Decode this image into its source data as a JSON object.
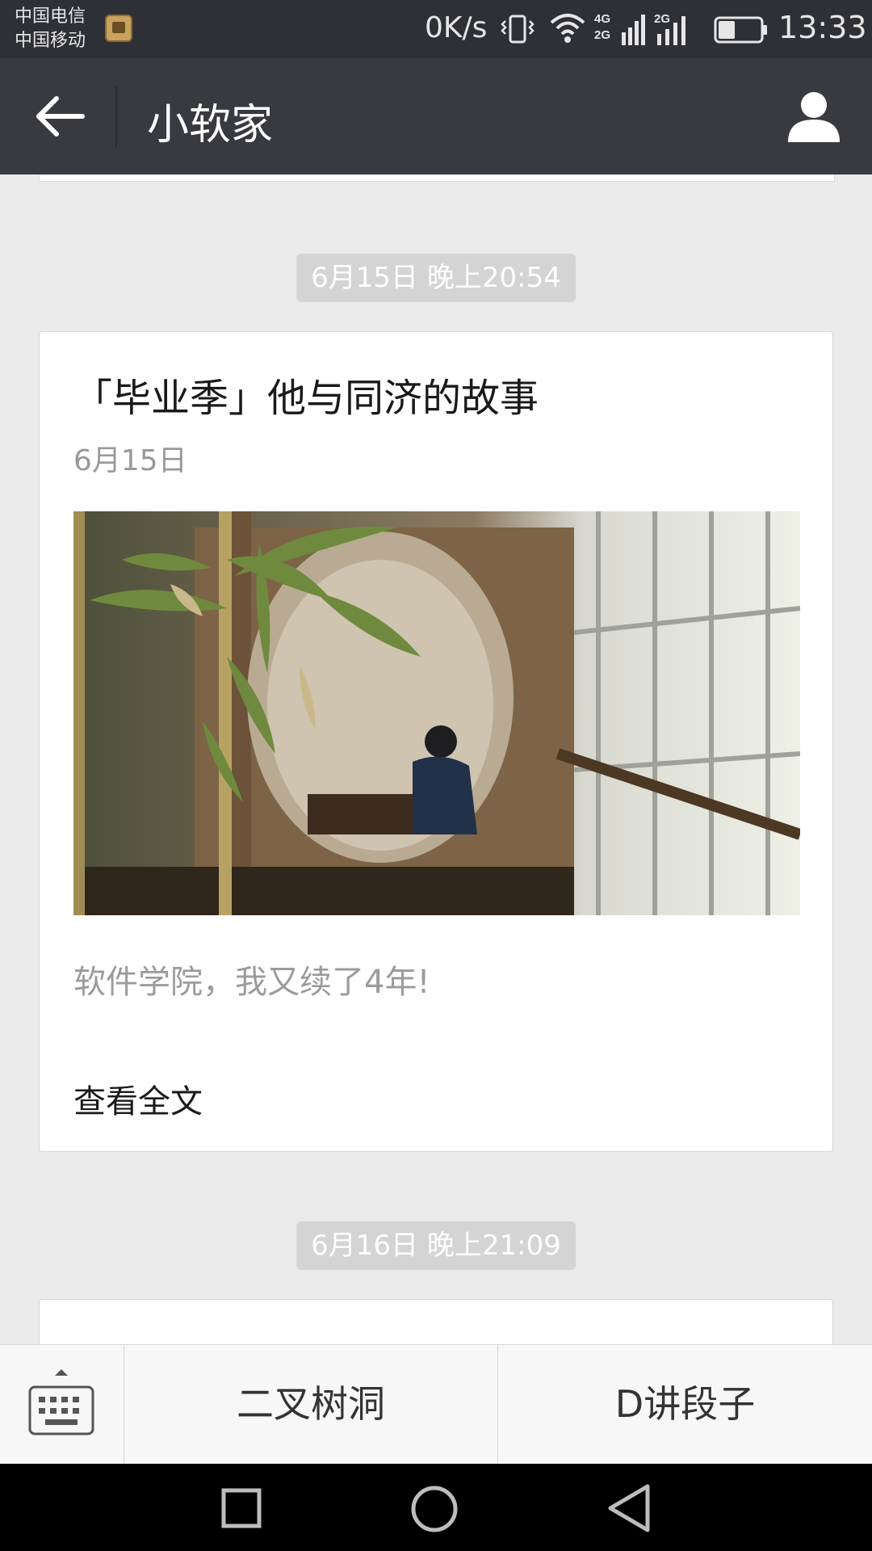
{
  "status_bar": {
    "carrier_1": "中国电信",
    "carrier_2": "中国移动",
    "net_speed": "0K/s",
    "net_type_1": "4G",
    "net_type_2": "2G",
    "net_type_3": "2G",
    "time": "13:33",
    "battery_level": 0.4
  },
  "header": {
    "title": "小软家"
  },
  "messages": [
    {
      "timestamp": "6月15日 晚上20:54",
      "article": {
        "title": "「毕业季」他与同济的故事",
        "date": "6月15日",
        "digest": "软件学院，我又续了4年!",
        "read_more": "查看全文"
      }
    },
    {
      "timestamp": "6月16日 晚上21:09"
    }
  ],
  "menu": {
    "items": [
      "二叉树洞",
      "D讲段子"
    ]
  },
  "colors": {
    "status_bar_bg": "#2f3035",
    "title_bar_bg": "#393a3f",
    "page_bg": "#ebebeb"
  }
}
